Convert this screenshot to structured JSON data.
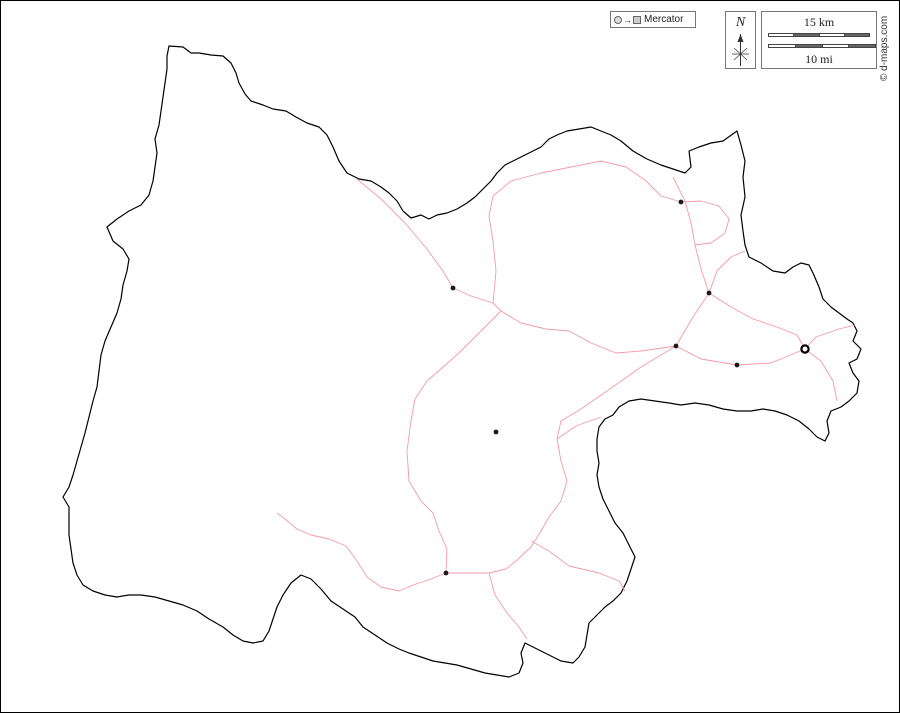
{
  "projection": {
    "label": "Mercator",
    "icon": "sphere-to-plane-icon"
  },
  "north_arrow": {
    "letter": "N",
    "icon": "compass-rose-icon"
  },
  "scale": {
    "km_label": "15 km",
    "mi_label": "10 mi"
  },
  "credit": "© d-maps.com",
  "colors": {
    "border": "#000000",
    "roads": "#f29aa6",
    "towns": "#1a1a1a",
    "background": "#ffffff"
  },
  "map": {
    "description_type": "blank outline map with roads and town markers",
    "town_markers": 7,
    "capital_markers": 1
  }
}
